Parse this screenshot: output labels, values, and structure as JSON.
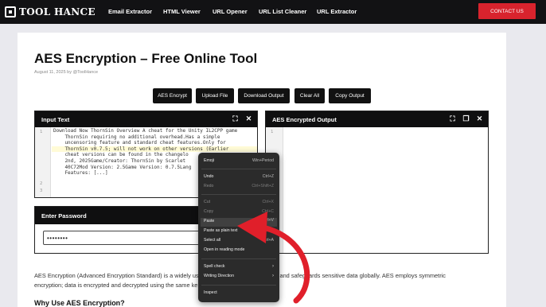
{
  "nav": {
    "logo": "TOOL HANCE",
    "items": [
      "Email Extractor",
      "HTML Viewer",
      "URL Opener",
      "URL List Cleaner",
      "URL Extractor"
    ],
    "contact": "CONTACT US"
  },
  "page": {
    "title": "AES Encryption – Free Online Tool",
    "meta": "August 11, 2025 by @ToolHance"
  },
  "toolbar": [
    "AES Encrypt",
    "Upload File",
    "Download Output",
    "Clear All",
    "Copy Output"
  ],
  "input_panel": {
    "title": "Input Text",
    "lines": [
      "1",
      "2",
      "3"
    ],
    "code": "Download Now ThornSin Overview A cheat for the Unity IL2CPP game\n    ThornSin requiring no additional overhead.Has a simple\n    uncensoring feature and standard cheat features.Only for\n    ThornSin v0.7.5; will not work on other versions (Earlier\n    cheat versions can be found in the changelo\n    2nd, 2025Game/Creator: ThornSin by Scarlet\n    40C72Mod Version: 2.5Game Version: 0.7.5Lang\n    Features: [...]"
  },
  "output_panel": {
    "title": "AES Encrypted Output",
    "lines": [
      "1"
    ]
  },
  "password": {
    "title": "Enter Password",
    "value": "••••••••"
  },
  "body": {
    "para1a": "AES Encryption (Advanced Encryption Standard) is a widely use",
    "para1b": "s fast, reliable, and safeguards sensitive data globally. AES employs symmetric",
    "para2": "encryption; data is encrypted and decrypted using the same ke",
    "h2": "Why Use AES Encryption?"
  },
  "context_menu": {
    "items": [
      {
        "label": "Emoji",
        "shortcut": "Win+Period"
      },
      {
        "label": "Undo",
        "shortcut": "Ctrl+Z"
      },
      {
        "label": "Redo",
        "shortcut": "Ctrl+Shift+Z"
      },
      {
        "label": "Cut",
        "shortcut": "Ctrl+X"
      },
      {
        "label": "Copy",
        "shortcut": "Ctrl+C"
      },
      {
        "label": "Paste",
        "shortcut": "Ctrl+V"
      },
      {
        "label": "Paste as plain text",
        "shortcut": "Ctrl+Shift+V"
      },
      {
        "label": "Select all",
        "shortcut": "Ctrl+A"
      },
      {
        "label": "Open in reading mode",
        "shortcut": ""
      },
      {
        "label": "Spell check",
        "shortcut": ""
      },
      {
        "label": "Writing Direction",
        "shortcut": ""
      },
      {
        "label": "Inspect",
        "shortcut": ""
      }
    ]
  },
  "colors": {
    "nav_bg": "#121214",
    "accent": "#d9232d",
    "panel_head": "#0f0f10",
    "menu_bg": "#2b2b2b",
    "arrow": "#e01f2a"
  }
}
